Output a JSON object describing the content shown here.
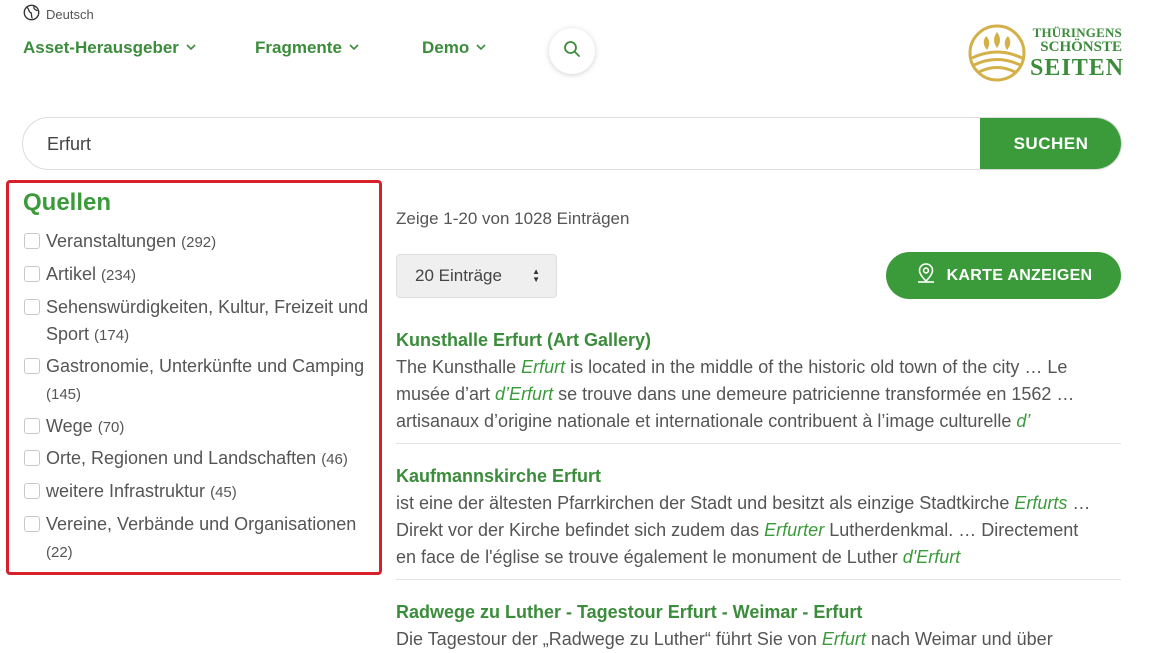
{
  "language": {
    "label": "Deutsch",
    "icon": "globe-icon"
  },
  "nav": [
    {
      "label": "Asset-Herausgeber"
    },
    {
      "label": "Fragmente"
    },
    {
      "label": "Demo"
    }
  ],
  "logo": {
    "line1": "THÜRINGENS",
    "line2": "SCHÖNSTE",
    "line3": "SEITEN"
  },
  "search": {
    "value": "Erfurt",
    "button": "SUCHEN"
  },
  "facets": {
    "title": "Quellen",
    "items": [
      {
        "label": "Veranstaltungen",
        "count": "(292)"
      },
      {
        "label": "Artikel",
        "count": "(234)"
      },
      {
        "label": "Sehenswürdigkeiten, Kultur, Freizeit und Sport",
        "count": "(174)"
      },
      {
        "label": "Gastronomie, Unterkünfte und Camping",
        "count": "(145)"
      },
      {
        "label": "Wege",
        "count": "(70)"
      },
      {
        "label": "Orte, Regionen und Landschaften",
        "count": "(46)"
      },
      {
        "label": "weitere Infrastruktur",
        "count": "(45)"
      },
      {
        "label": "Vereine, Verbände und Organisationen",
        "count": "(22)"
      }
    ]
  },
  "results_summary": "Zeige 1-20 von 1028 Einträgen",
  "per_page": "20 Einträge",
  "map_button": "KARTE ANZEIGEN",
  "results": [
    {
      "title": "Kunsthalle Erfurt (Art Gallery)",
      "lines": [
        [
          "The Kunsthalle ",
          "Erfurt",
          " is located in the middle of the historic old town of the city … Le"
        ],
        [
          "musée d’art ",
          "d’Erfurt",
          " se trouve dans une demeure patricienne transformée en 1562 …"
        ],
        [
          "artisanaux d’origine nationale et internationale contribuent à l’image culturelle ",
          "d’",
          ""
        ]
      ]
    },
    {
      "title": "Kaufmannskirche Erfurt",
      "lines": [
        [
          "ist eine der ältesten Pfarrkirchen der Stadt und besitzt als einzige Stadtkirche ",
          "Erfurts",
          " …"
        ],
        [
          "Direkt vor der Kirche befindet sich zudem das ",
          "Erfurter",
          " Lutherdenkmal. … Directement"
        ],
        [
          "en face de l'église se trouve également le monument de Luther ",
          "d'Erfurt",
          ""
        ]
      ]
    },
    {
      "title": "Radwege zu Luther - Tagestour Erfurt - Weimar - Erfurt",
      "lines": [
        [
          "Die Tagestour der „Radwege zu Luther“ führt Sie von ",
          "Erfurt",
          " nach Weimar und über"
        ]
      ]
    }
  ],
  "colors": {
    "brand_green": "#3b9b3b",
    "highlight_border": "#d8202a",
    "logo_gold": "#d4b048"
  }
}
